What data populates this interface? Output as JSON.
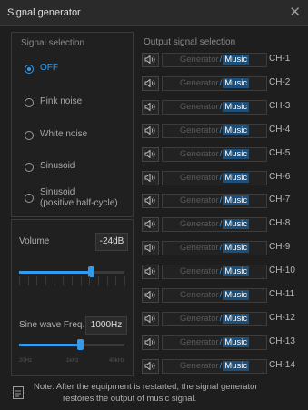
{
  "window": {
    "title": "Signal generator",
    "close_icon": "close-icon"
  },
  "signal_selection": {
    "title": "Signal selection",
    "options": [
      {
        "label": "OFF",
        "selected": true
      },
      {
        "label": "Pink noise",
        "selected": false
      },
      {
        "label": "White noise",
        "selected": false
      },
      {
        "label": "Sinusoid",
        "selected": false
      },
      {
        "label_line1": "Sinusoid",
        "label_line2": "(positive half-cycle)",
        "selected": false
      }
    ]
  },
  "volume": {
    "label": "Volume",
    "value": "-24dB",
    "slider_level": 0.68
  },
  "sine_freq": {
    "label": "Sine wave Freq.",
    "value": "1000Hz",
    "slider_level": 0.58,
    "scale": [
      "20Hz",
      "1kHz",
      "40kHz"
    ]
  },
  "output": {
    "title": "Output signal selection",
    "generator_label": "Generator",
    "separator": "/",
    "music_label": "Music",
    "channels": [
      "CH-1",
      "CH-2",
      "CH-3",
      "CH-4",
      "CH-5",
      "CH-6",
      "CH-7",
      "CH-8",
      "CH-9",
      "CH-10",
      "CH-11",
      "CH-12",
      "CH-13",
      "CH-14"
    ]
  },
  "note": {
    "line1": "Note: After the equipment is restarted, the signal generator",
    "line2": "restores the output of music signal."
  },
  "colors": {
    "accent": "#2f9cf0",
    "background": "#1e1e1e"
  }
}
